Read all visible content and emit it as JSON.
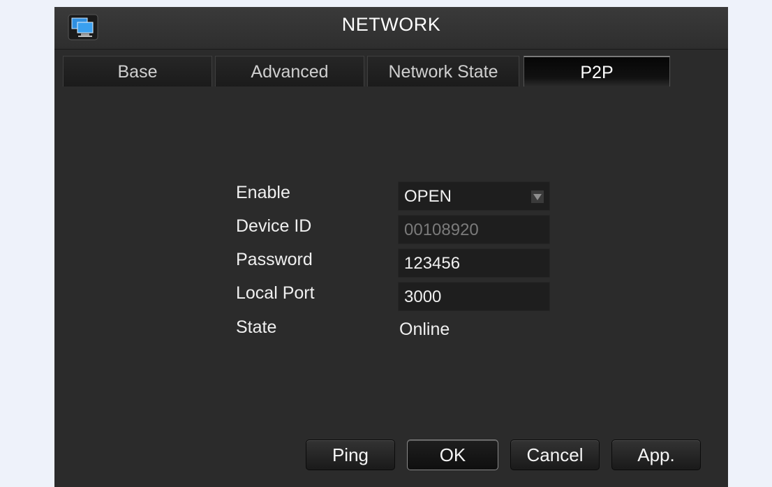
{
  "window": {
    "title": "NETWORK",
    "icon": "network-computers-icon"
  },
  "tabs": [
    {
      "label": "Base",
      "active": false
    },
    {
      "label": "Advanced",
      "active": false
    },
    {
      "label": "Network State",
      "active": false
    },
    {
      "label": "P2P",
      "active": true
    }
  ],
  "p2p": {
    "enable": {
      "label": "Enable",
      "value": "OPEN"
    },
    "device_id": {
      "label": "Device ID",
      "value": "00108920"
    },
    "password": {
      "label": "Password",
      "value": "123456"
    },
    "local_port": {
      "label": "Local Port",
      "value": "3000"
    },
    "state": {
      "label": "State",
      "value": "Online"
    }
  },
  "buttons": {
    "ping": "Ping",
    "ok": "OK",
    "cancel": "Cancel",
    "apply": "App."
  }
}
